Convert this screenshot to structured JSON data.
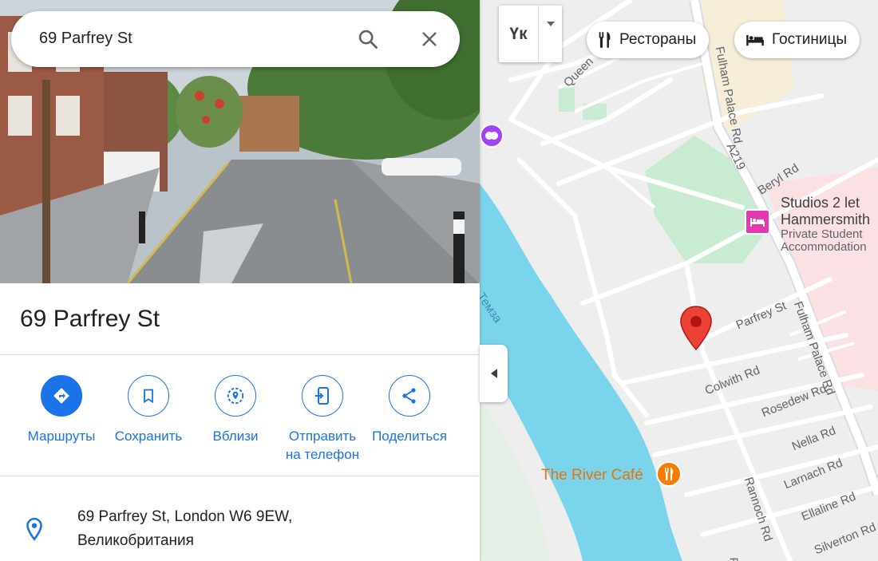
{
  "search": {
    "query": "69 Parfrey St"
  },
  "place": {
    "title": "69 Parfrey St",
    "address_line1": "69 Parfrey St, London W6 9EW,",
    "address_line2": "Великобритания"
  },
  "actions": [
    {
      "label": "Маршруты",
      "icon": "directions-icon"
    },
    {
      "label": "Сохранить",
      "icon": "bookmark-icon"
    },
    {
      "label": "Вблизи",
      "icon": "nearby-icon"
    },
    {
      "label": "Отправить",
      "label2": "на телефон",
      "icon": "send-to-phone-icon"
    },
    {
      "label": "Поделиться",
      "icon": "share-icon"
    }
  ],
  "map": {
    "layer_button_label": "Үк",
    "chips": [
      {
        "label": "Рестораны",
        "icon": "restaurant-icon"
      },
      {
        "label": "Гостиницы",
        "icon": "hotel-icon"
      }
    ],
    "street_labels": {
      "fulham_palace_top": "Fulham Palace Rd",
      "fulham_palace_bottom": "Fulham Palace Rd",
      "a219": "A219",
      "beryl": "Beryl Rd",
      "queen": "Queen",
      "parfrey": "Parfrey St",
      "colwith": "Colwith Rd",
      "rosedew": "Rosedew Rd",
      "nella": "Nella Rd",
      "larnach": "Larnach Rd",
      "ellaline": "Ellaline Rd",
      "rannoch": "Rannoch Rd",
      "silverton": "Silverton Rd",
      "river": "Темза",
      "pe": "Pe"
    },
    "pois": {
      "studios_name_1": "Studios 2 let",
      "studios_name_2": "Hammersmith",
      "studios_sub_1": "Private Student",
      "studios_sub_2": "Accommodation",
      "cafe": "The River Café"
    },
    "colors": {
      "water": "#7ad5ec",
      "park": "#c8ebd2",
      "road": "#ffffff",
      "land": "#eeeeee",
      "pin": "#ea4335",
      "accent": "#1a73e8"
    }
  }
}
